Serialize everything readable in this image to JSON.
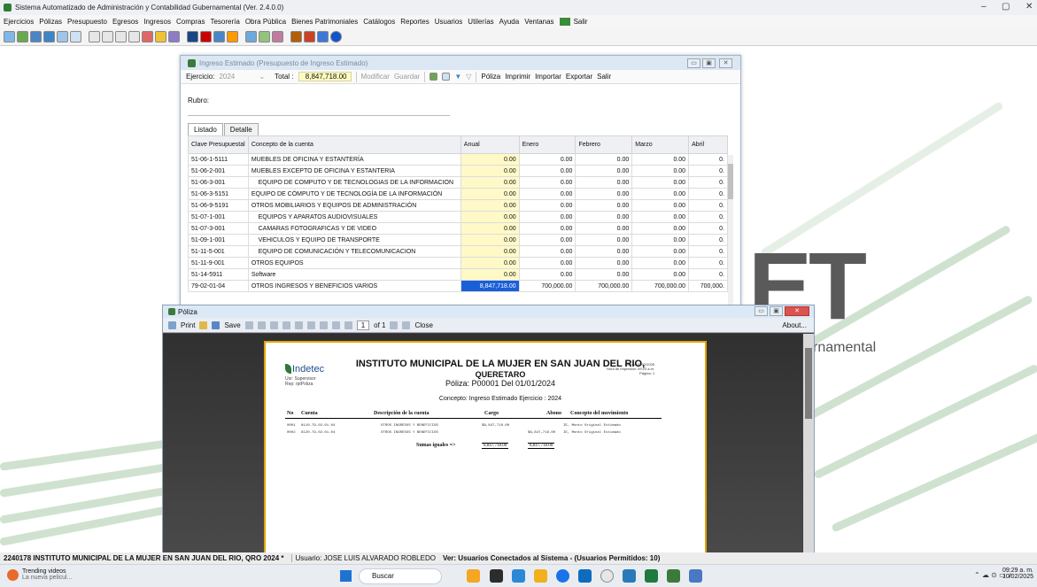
{
  "app": {
    "title": "Sistema Automatizado de Administración y Contabilidad Gubernamental (Ver. 2.4.0.0)",
    "window_controls": [
      "–",
      "▢",
      "✕"
    ]
  },
  "menu": [
    "Ejercicios",
    "Pólizas",
    "Presupuesto",
    "Egresos",
    "Ingresos",
    "Compras",
    "Tesorería",
    "Obra Pública",
    "Bienes Patrimoniales",
    "Catálogos",
    "Reportes",
    "Usuarios",
    "Utilerías",
    "Ayuda",
    "Ventanas",
    "Salir"
  ],
  "background": {
    "logo_text": "ET",
    "subtitle": "rnamental"
  },
  "ingreso": {
    "title": "Ingreso Estimado (Presupuesto de Ingreso Estimado)",
    "ejercicio_label": "Ejercicio:",
    "ejercicio_value": "2024",
    "total_label": "Total :",
    "total_value": "8,847,718.00",
    "modificar": "Modificar",
    "guardar": "Guardar",
    "poliza": "Póliza",
    "imprimir": "Imprimir",
    "importar": "Importar",
    "exportar": "Exportar",
    "salir": "Salir",
    "rubro_label": "Rubro:",
    "tab_listado": "Listado",
    "tab_detalle": "Detalle",
    "columns": [
      "Clave Presupuestal",
      "Concepto de la cuenta",
      "Anual",
      "Enero",
      "Febrero",
      "Marzo",
      "Abril"
    ],
    "rows": [
      {
        "clave": "51-06-1-5111",
        "concepto": "MUEBLES DE OFICINA Y ESTANTERÍA",
        "anual": "0.00",
        "enero": "0.00",
        "febrero": "0.00",
        "marzo": "0.00",
        "abril": "0."
      },
      {
        "clave": "51-06-2-001",
        "concepto": "MUEBLES EXCEPTO DE OFICINA Y ESTANTERIA",
        "anual": "0.00",
        "enero": "0.00",
        "febrero": "0.00",
        "marzo": "0.00",
        "abril": "0."
      },
      {
        "clave": "51-06-3-001",
        "concepto": "    EQUIPO DE COMPUTO Y DE TECNOLOGIAS DE LA INFORMACION",
        "anual": "0.00",
        "enero": "0.00",
        "febrero": "0.00",
        "marzo": "0.00",
        "abril": "0."
      },
      {
        "clave": "51-06-3-5151",
        "concepto": "EQUIPO DE CÓMPUTO Y DE TECNOLOGÍA DE LA INFORMACIÓN",
        "anual": "0.00",
        "enero": "0.00",
        "febrero": "0.00",
        "marzo": "0.00",
        "abril": "0."
      },
      {
        "clave": "51-06-9-5191",
        "concepto": "OTROS MOBILIARIOS Y EQUIPOS DE ADMINISTRACIÓN",
        "anual": "0.00",
        "enero": "0.00",
        "febrero": "0.00",
        "marzo": "0.00",
        "abril": "0."
      },
      {
        "clave": "51-07-1-001",
        "concepto": "    EQUIPOS Y APARATOS AUDIOVISUALES",
        "anual": "0.00",
        "enero": "0.00",
        "febrero": "0.00",
        "marzo": "0.00",
        "abril": "0."
      },
      {
        "clave": "51-07-3-001",
        "concepto": "    CAMARAS FOTOGRAFICAS Y DE VIDEO",
        "anual": "0.00",
        "enero": "0.00",
        "febrero": "0.00",
        "marzo": "0.00",
        "abril": "0."
      },
      {
        "clave": "51-09-1-001",
        "concepto": "    VEHICULOS Y EQUIPO DE TRANSPORTE",
        "anual": "0.00",
        "enero": "0.00",
        "febrero": "0.00",
        "marzo": "0.00",
        "abril": "0."
      },
      {
        "clave": "51-11-5-001",
        "concepto": "    EQUIPO DE COMUNICACIÓN Y TELECOMUNICACION",
        "anual": "0.00",
        "enero": "0.00",
        "febrero": "0.00",
        "marzo": "0.00",
        "abril": "0."
      },
      {
        "clave": "51-11-9-001",
        "concepto": "OTROS EQUIPOS",
        "anual": "0.00",
        "enero": "0.00",
        "febrero": "0.00",
        "marzo": "0.00",
        "abril": "0."
      },
      {
        "clave": "51-14-5911",
        "concepto": "Software",
        "anual": "0.00",
        "enero": "0.00",
        "febrero": "0.00",
        "marzo": "0.00",
        "abril": "0."
      },
      {
        "clave": "79-02-01-04",
        "concepto": "OTROS INGRESOS Y BENEFICIOS VARIOS",
        "anual": "8,847,718.00",
        "enero": "700,000.00",
        "febrero": "700,000.00",
        "marzo": "700,000.00",
        "abril": "700,000.",
        "selected": true
      }
    ]
  },
  "poliza": {
    "title": "Póliza",
    "print": "Print",
    "save": "Save",
    "page_current": "1",
    "page_of": "of 1",
    "close": "Close",
    "about": "About...",
    "report": {
      "logo": "Indetec",
      "usr_line": "Usr: Supervisor",
      "rep_line": "Rep: rptPoliza",
      "institution": "INSTITUTO MUNICIPAL DE LA MUJER EN SAN JUAN DEL RIO,",
      "city": "QUERETARO",
      "poliza_line": "Póliza:  P00001  Del 01/01/2024",
      "concepto": "Concepto: Ingreso Estimado Ejercicio : 2024",
      "fecha_label": "Fecha:",
      "fecha_value": "10/02/2025",
      "hora_label": "Hora de Impresión:",
      "hora_value": "09:23 a.m.",
      "pagina_label": "Página:",
      "pagina_value": "1",
      "headers": [
        "No",
        "Cuenta",
        "Descripción de la cuenta",
        "Cargo",
        "Abono",
        "Concepto del movimiento"
      ],
      "lines": [
        {
          "no": "0001",
          "cuenta": "8110-79-02-01-04",
          "desc": "OTROS INGRESOS Y BENEFICIOS",
          "cargo": "$8,847,718.00",
          "abono": "",
          "concepto": "IE, Monto Original Estimado"
        },
        {
          "no": "0002",
          "cuenta": "8120-79-02-01-04",
          "desc": "OTROS INGRESOS Y BENEFICIOS",
          "cargo": "",
          "abono": "$8,847,718.00",
          "concepto": "IE, Monto Original Estimado"
        }
      ],
      "sumas_label": "Sumas iguales =>",
      "sumas_cargo": "8,847,718.00",
      "sumas_abono": "8,847,718.00"
    }
  },
  "statusbar": {
    "entity": "2240178 INSTITUTO MUNICIPAL DE LA MUJER EN SAN JUAN DEL RIO, QRO  2024  *",
    "user": "Usuario: JOSE LUIS ALVARADO ROBLEDO",
    "connected": "Ver: Usuarios Conectados al Sistema - (Usuarios Permitidos: 10)"
  },
  "taskbar": {
    "weather_title": "Trending videos",
    "weather_sub": "La nueva pelicul...",
    "search": "Buscar",
    "time": "09:29 a. m.",
    "date": "10/02/2025"
  }
}
